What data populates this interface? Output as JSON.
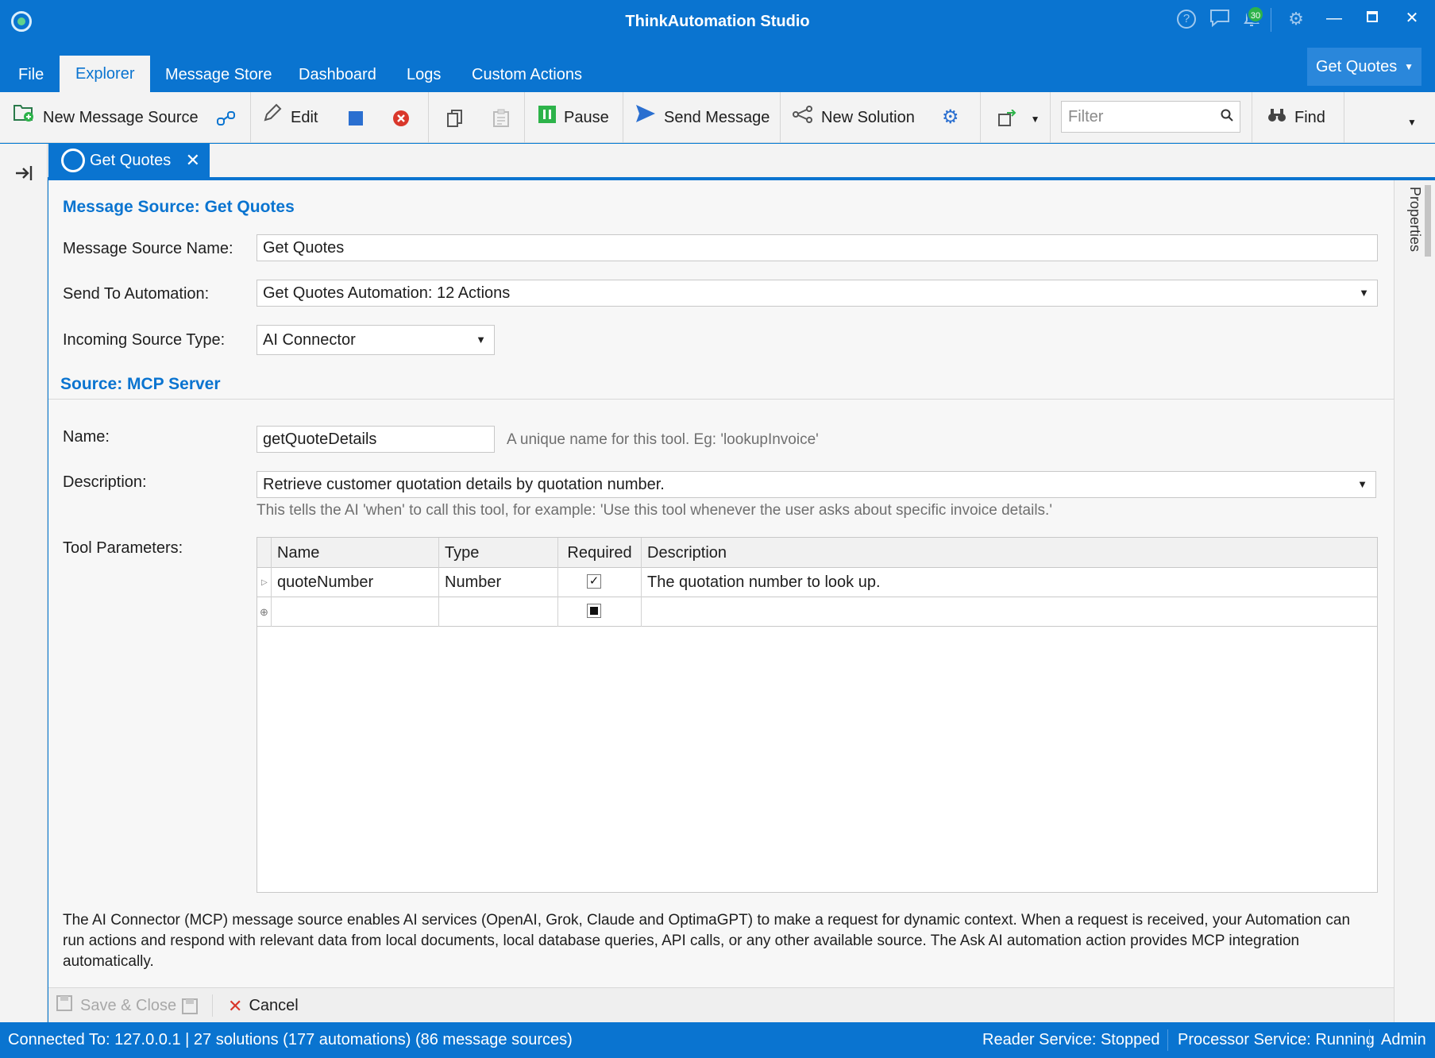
{
  "window": {
    "title": "ThinkAutomation Studio"
  },
  "title_icons": {
    "notification_count": "30"
  },
  "menu": {
    "items": [
      "File",
      "Explorer",
      "Message Store",
      "Dashboard",
      "Logs",
      "Custom Actions"
    ],
    "active": "Explorer",
    "context_button": "Get Quotes"
  },
  "toolbar": {
    "new_message_source": "New Message Source",
    "edit": "Edit",
    "pause": "Pause",
    "send_message": "Send Message",
    "new_solution": "New Solution",
    "filter_placeholder": "Filter",
    "find": "Find"
  },
  "doc_tab": {
    "label": "Get Quotes"
  },
  "form": {
    "section_title": "Message Source: Get Quotes",
    "name_label": "Message Source Name:",
    "name_value": "Get Quotes",
    "automation_label": "Send To Automation:",
    "automation_value": "Get Quotes Automation: 12 Actions",
    "source_type_label": "Incoming Source Type:",
    "source_type_value": "AI Connector",
    "source_section_title": "Source: MCP Server",
    "tool_name_label": "Name:",
    "tool_name_value": "getQuoteDetails",
    "tool_name_hint": "A unique name for this tool. Eg: 'lookupInvoice'",
    "description_label": "Description:",
    "description_value": "Retrieve customer quotation details by quotation number.",
    "description_hint": "This tells the AI 'when' to call this tool, for example: 'Use this tool whenever the user asks about specific invoice details.'",
    "params_label": "Tool Parameters:"
  },
  "params_grid": {
    "columns": [
      "Name",
      "Type",
      "Required",
      "Description"
    ],
    "rows": [
      {
        "name": "quoteNumber",
        "type": "Number",
        "required": true,
        "description": "The quotation number to look up."
      }
    ]
  },
  "info_text": "The AI Connector (MCP) message source enables AI services (OpenAI, Grok, Claude and OptimaGPT) to make a request for dynamic context. When a request is received, your Automation can run actions and respond with relevant data from local documents, local database queries, API calls, or any other available source. The Ask AI automation action provides MCP integration automatically.",
  "side_panel": {
    "label": "Properties"
  },
  "footer": {
    "save_close": "Save & Close",
    "cancel": "Cancel"
  },
  "status": {
    "connection": "Connected To: 127.0.0.1 | 27 solutions (177 automations) (86 message sources)",
    "reader": "Reader Service: Stopped",
    "processor": "Processor Service: Running",
    "user": "Admin"
  },
  "colors": {
    "accent": "#0a74d0",
    "pause_green": "#2db34a",
    "cancel_red": "#d9372b"
  }
}
